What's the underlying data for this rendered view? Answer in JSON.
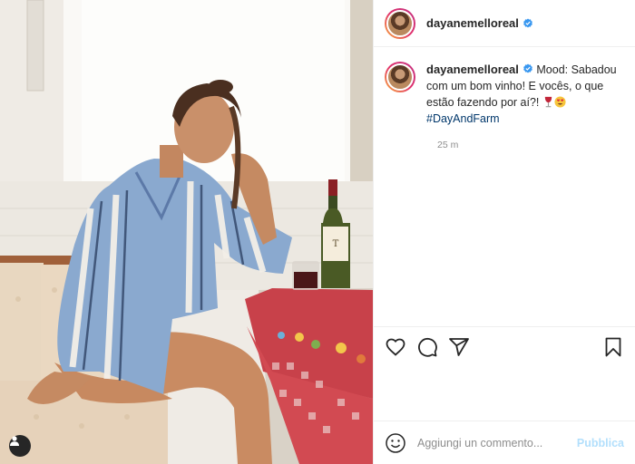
{
  "post": {
    "photo_alt": "",
    "user_tag_icon": "user-icon"
  },
  "header": {
    "username": "dayanemelloreal",
    "verified_icon": "verified-badge-icon"
  },
  "caption": {
    "username": "dayanemelloreal",
    "text": "Mood: Sabadou com um bom vinho! E vocês, o que estão fazendo por aí?! ",
    "emoji": [
      "wine-glass-emoji",
      "heart-eyes-emoji"
    ],
    "hashtag": "#DayAndFarm",
    "time": "25 m"
  },
  "actions": {
    "icons": [
      "heart-icon",
      "comment-icon",
      "share-icon",
      "bookmark-icon"
    ]
  },
  "comment_box": {
    "placeholder": "Aggiungi un commento...",
    "publish_label": "Pubblica"
  },
  "colors": {
    "brand_link": "#00376b",
    "publish_disabled": "#b2dffc",
    "verified_blue": "#3897f0"
  }
}
